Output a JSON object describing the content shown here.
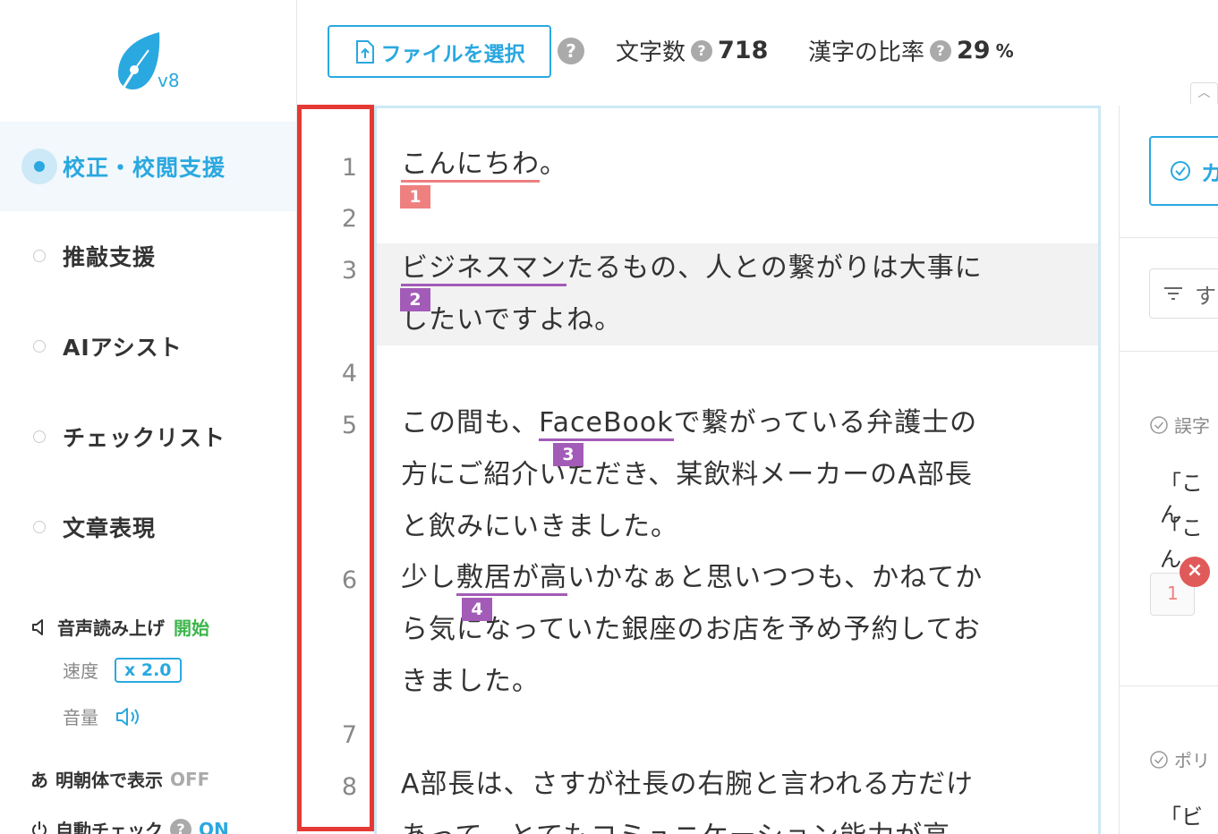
{
  "sidebar": {
    "version": "v8",
    "items": [
      {
        "label": "校正・校閲支援",
        "active": true
      },
      {
        "label": "推敲支援",
        "active": false
      },
      {
        "label": "AIアシスト",
        "active": false
      },
      {
        "label": "チェックリスト",
        "active": false
      },
      {
        "label": "文章表現",
        "active": false
      }
    ],
    "speech": {
      "label": "音声読み上げ",
      "start": "開始",
      "speed_label": "速度",
      "speed_value": "x 2.0",
      "volume_label": "音量"
    },
    "mincho": {
      "label": "明朝体で表示",
      "state": "OFF",
      "prefix": "あ"
    },
    "autocheck": {
      "label": "自動チェック",
      "state": "ON"
    }
  },
  "toolbar": {
    "file_button": "ファイルを選択",
    "char_count_label": "文字数",
    "char_count_value": "718",
    "kanji_ratio_label": "漢字の比率",
    "kanji_ratio_value": "29",
    "kanji_ratio_unit": "%"
  },
  "editor": {
    "line_numbers": [
      "1",
      "2",
      "3",
      "4",
      "5",
      "6",
      "7",
      "8"
    ],
    "p1": {
      "u": "こんにちわ",
      "rest": "。",
      "badge": "1"
    },
    "p3": {
      "u": "ビジネスマン",
      "rest": "たるもの、人との繋がりは大事に",
      "line2": "したいですよね。",
      "badge": "2"
    },
    "p5": {
      "pre": "この間も、",
      "u": "FaceBook",
      "rest": "で繋がっている弁護士の",
      "line2": "方にご紹介いただき、某飲料メーカーのA部長",
      "line3": "と飲みにいきました。",
      "badge": "3"
    },
    "p6": {
      "pre": "少し",
      "u": "敷居が高",
      "rest": "いかなぁと思いつつも、かねてか",
      "line2": "ら気になっていた銀座のお店を予め予約してお",
      "line3": "きました。",
      "badge": "4"
    },
    "p8": {
      "line1": "A部長は、さすが社長の右腕と言われる方だけ",
      "line2": "あって、とてもコミュニケーション能力が高"
    }
  },
  "right_panel": {
    "check_button": "カ",
    "filter": "す",
    "cat1": "誤字",
    "quote1": "「こん",
    "quote2": "「こん",
    "num": "1",
    "cat2": "ポリ",
    "quote3": "「ビジ"
  },
  "colors": {
    "accent": "#2aa8e0",
    "error_red": "#ef8080",
    "purple": "#a35bb8",
    "gutter_border": "#e53935"
  }
}
